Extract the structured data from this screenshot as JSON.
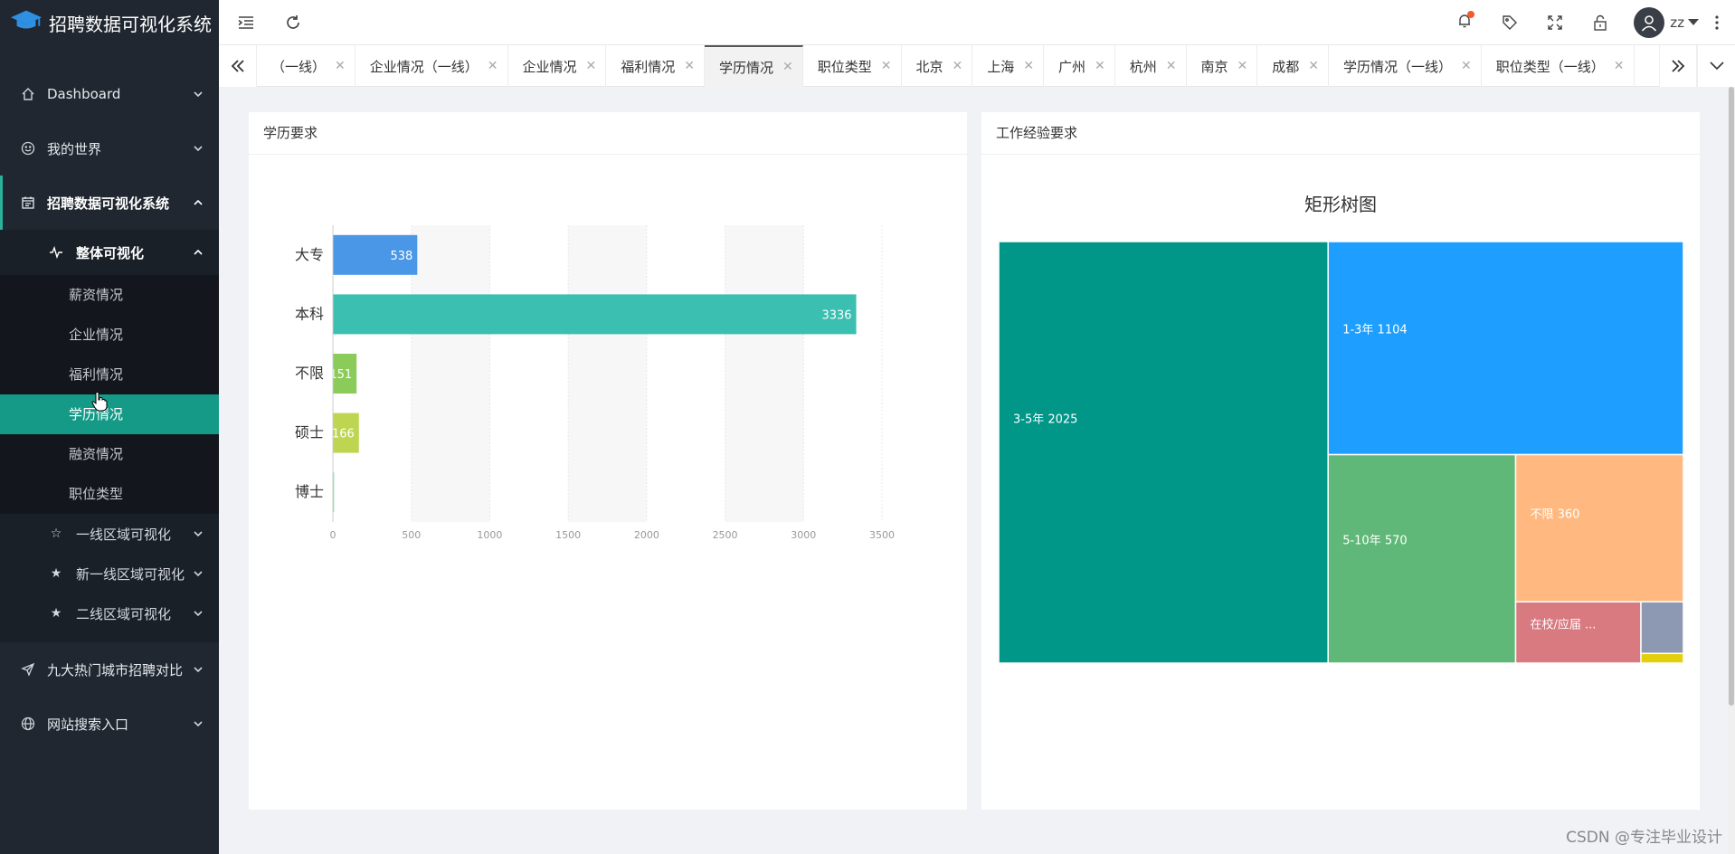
{
  "app": {
    "title": "招聘数据可视化系统"
  },
  "sidebar": {
    "items": [
      {
        "label": "Dashboard"
      },
      {
        "label": "我的世界"
      },
      {
        "label": "招聘数据可视化系统"
      }
    ],
    "overall": {
      "label": "整体可视化"
    },
    "leaves": [
      "薪资情况",
      "企业情况",
      "福利情况",
      "学历情况",
      "融资情况",
      "职位类型"
    ],
    "regions": [
      "一线区域可视化",
      "新一线区域可视化",
      "二线区域可视化"
    ],
    "bottom": [
      "九大热门城市招聘对比",
      "网站搜索入口"
    ]
  },
  "topbar": {
    "username": "zz"
  },
  "tabs": [
    "（一线）",
    "企业情况（一线）",
    "企业情况",
    "福利情况",
    "学历情况",
    "职位类型",
    "北京",
    "上海",
    "广州",
    "杭州",
    "南京",
    "成都",
    "学历情况（一线）",
    "职位类型（一线）"
  ],
  "cards": {
    "education": {
      "title": "学历要求"
    },
    "experience": {
      "title": "工作经验要求"
    }
  },
  "chart_data": [
    {
      "type": "bar",
      "orientation": "horizontal",
      "categories": [
        "大专",
        "本科",
        "不限",
        "硕士",
        "博士"
      ],
      "values": [
        538,
        3336,
        151,
        166,
        8
      ],
      "data_labels": [
        "538",
        "3336",
        "151",
        "166",
        ""
      ],
      "colors": [
        "#4a97e8",
        "#3bbfb0",
        "#8bcb5a",
        "#bed552",
        "#96e0b0"
      ],
      "xlim": [
        0,
        3500
      ],
      "xticks": [
        0,
        500,
        1000,
        1500,
        2000,
        2500,
        3000,
        3500
      ],
      "grid": "alternating vertical bands"
    },
    {
      "type": "treemap",
      "title": "矩形树图",
      "items": [
        {
          "name": "3-5年",
          "value": 2025,
          "label": "3-5年 2025",
          "color": "#009688"
        },
        {
          "name": "1-3年",
          "value": 1104,
          "label": "1-3年 1104",
          "color": "#1e9fff"
        },
        {
          "name": "5-10年",
          "value": 570,
          "label": "5-10年 570",
          "color": "#5fb878"
        },
        {
          "name": "不限",
          "value": 360,
          "label": "不限 360",
          "color": "#ffb980"
        },
        {
          "name": "在校/应届",
          "value": 112,
          "label": "在校/应届 ...",
          "color": "#d87a80"
        },
        {
          "name": "",
          "value": 32,
          "label": "",
          "color": "#8d98b3"
        },
        {
          "name": "",
          "value": 6,
          "label": "",
          "color": "#e5cf0d"
        }
      ]
    }
  ],
  "watermark": "CSDN @专注毕业设计",
  "colors": {
    "sidebar_bg": "#202730",
    "accent": "#159a87"
  }
}
